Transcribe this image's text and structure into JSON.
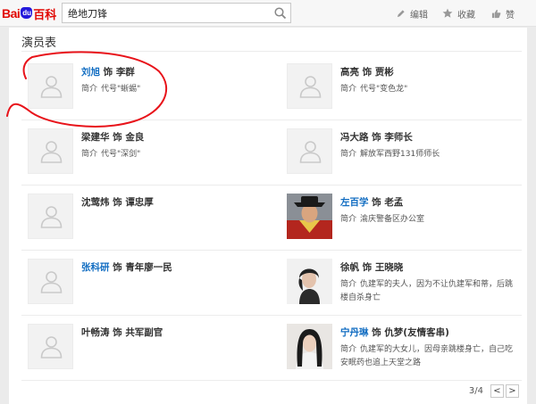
{
  "header": {
    "logo": {
      "bai": "Bai",
      "paw": "du",
      "baike": "百科"
    },
    "search": {
      "value": "绝地刀锋"
    },
    "tools": {
      "edit": "编辑",
      "favorite": "收藏",
      "like": "赞"
    }
  },
  "section": {
    "title": "演员表"
  },
  "actors": [
    {
      "name": "刘旭",
      "role_prefix": "饰",
      "role": "李群",
      "desc_label": "简介",
      "desc": "代号\"蜥蜴\"",
      "linked": true,
      "photo": false
    },
    {
      "name": "高亮",
      "role_prefix": "饰",
      "role": "贾彬",
      "desc_label": "简介",
      "desc": "代号\"变色龙\"",
      "linked": false,
      "photo": false
    },
    {
      "name": "梁建华",
      "role_prefix": "饰",
      "role": "金良",
      "desc_label": "简介",
      "desc": "代号\"深剑\"",
      "linked": false,
      "photo": false
    },
    {
      "name": "冯大路",
      "role_prefix": "饰",
      "role": "李师长",
      "desc_label": "简介",
      "desc": "解放军西野131师师长",
      "linked": false,
      "photo": false
    },
    {
      "name": "沈莺炜",
      "role_prefix": "饰",
      "role": "谭忠厚",
      "desc_label": "",
      "desc": "",
      "linked": false,
      "photo": false
    },
    {
      "name": "左百学",
      "role_prefix": "饰",
      "role": "老孟",
      "desc_label": "简介",
      "desc": "渝庆警备区办公室",
      "linked": true,
      "photo": true
    },
    {
      "name": "张科研",
      "role_prefix": "饰",
      "role": "青年廖一民",
      "desc_label": "",
      "desc": "",
      "linked": true,
      "photo": false
    },
    {
      "name": "徐帆",
      "role_prefix": "饰",
      "role": "王晓晓",
      "desc_label": "简介",
      "desc": "仇建军的夫人，因为不让仇建军和蒂，后跳楼自杀身亡",
      "linked": false,
      "photo": true
    },
    {
      "name": "叶畅涛",
      "role_prefix": "饰",
      "role": "共军副官",
      "desc_label": "",
      "desc": "",
      "linked": false,
      "photo": false
    },
    {
      "name": "宁丹琳",
      "role_prefix": "饰",
      "role": "仇梦(友情客串)",
      "desc_label": "简介",
      "desc": "仇建军的大女儿，因母亲跳楼身亡，自己吃安眠药也追上天堂之路",
      "linked": true,
      "photo": true
    }
  ],
  "pager": {
    "text": "3/4",
    "prev": "<",
    "next": ">"
  },
  "colors": {
    "link": "#136ec2",
    "annotation": "#e8131a",
    "logo_red": "#e10601",
    "logo_blue": "#2319dc"
  }
}
